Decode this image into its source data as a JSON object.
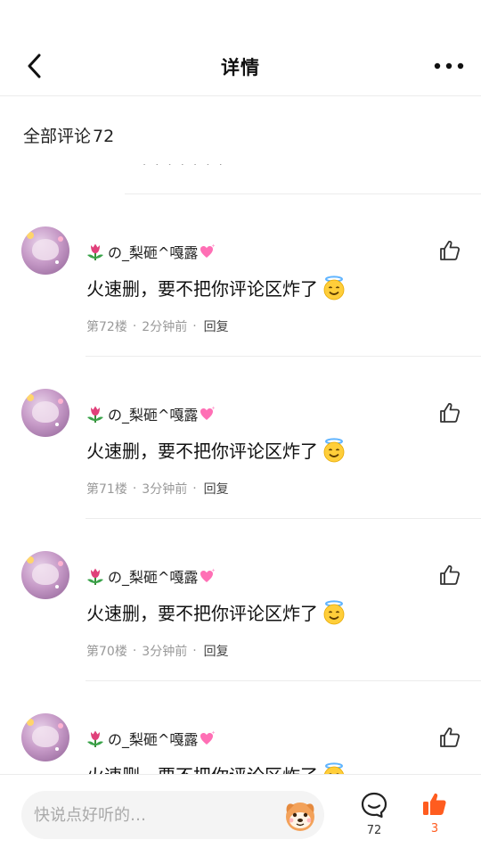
{
  "nav": {
    "title": "详情"
  },
  "section": {
    "label": "全部评论",
    "count": "72"
  },
  "comments": [
    {
      "user": "の_梨砸^嘎露",
      "text": "火速删，要不把你评论区炸了",
      "floor": "第72楼",
      "time": "2分钟前",
      "reply": "回复",
      "likes": ""
    },
    {
      "user": "の_梨砸^嘎露",
      "text": "火速删，要不把你评论区炸了",
      "floor": "第71楼",
      "time": "3分钟前",
      "reply": "回复",
      "likes": ""
    },
    {
      "user": "の_梨砸^嘎露",
      "text": "火速删，要不把你评论区炸了",
      "floor": "第70楼",
      "time": "3分钟前",
      "reply": "回复",
      "likes": ""
    },
    {
      "user": "の_梨砸^嘎露",
      "text": "火速删，要不把你评论区炸了",
      "floor": "",
      "time": "",
      "reply": "",
      "likes": ""
    }
  ],
  "bottom": {
    "input_placeholder": "快说点好听的…",
    "comment_count": "72",
    "like_count": "3"
  },
  "colors": {
    "accent": "#ff5c1f",
    "muted": "#999999"
  }
}
